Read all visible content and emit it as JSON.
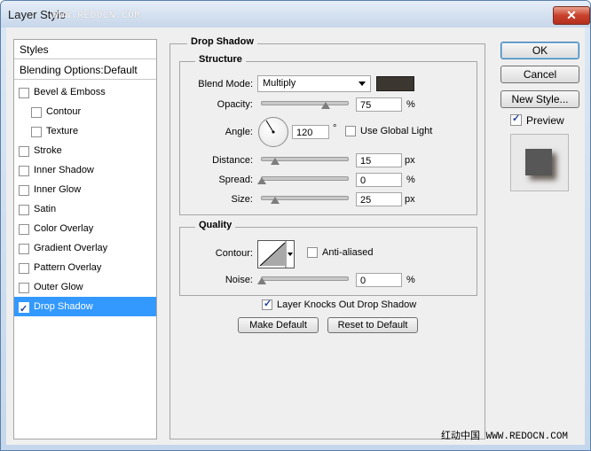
{
  "window": {
    "title": "Layer Style",
    "watermark_top": "WWW.REDOCN.COM",
    "close_glyph": "✕"
  },
  "left_panel": {
    "header_styles": "Styles",
    "header_blending": "Blending Options:Default",
    "items": [
      {
        "label": "Bevel & Emboss",
        "checked": false
      },
      {
        "label": "Contour",
        "checked": false
      },
      {
        "label": "Texture",
        "checked": false
      },
      {
        "label": "Stroke",
        "checked": false
      },
      {
        "label": "Inner Shadow",
        "checked": false
      },
      {
        "label": "Inner Glow",
        "checked": false
      },
      {
        "label": "Satin",
        "checked": false
      },
      {
        "label": "Color Overlay",
        "checked": false
      },
      {
        "label": "Gradient Overlay",
        "checked": false
      },
      {
        "label": "Pattern Overlay",
        "checked": false
      },
      {
        "label": "Outer Glow",
        "checked": false
      },
      {
        "label": "Drop Shadow",
        "checked": true
      }
    ]
  },
  "drop_shadow": {
    "group_title": "Drop Shadow",
    "structure": {
      "title": "Structure",
      "blend_mode_label": "Blend Mode:",
      "blend_mode_value": "Multiply",
      "blend_color": "#3c3630",
      "opacity_label": "Opacity:",
      "opacity_value": "75",
      "opacity_unit": "%",
      "opacity_fraction": 0.75,
      "angle_label": "Angle:",
      "angle_value": "120",
      "angle_unit": "°",
      "global_light_label": "Use Global Light",
      "global_light_checked": false,
      "distance_label": "Distance:",
      "distance_value": "15",
      "distance_unit": "px",
      "distance_fraction": 0.06,
      "spread_label": "Spread:",
      "spread_value": "0",
      "spread_unit": "%",
      "spread_fraction": 0.0,
      "size_label": "Size:",
      "size_value": "25",
      "size_unit": "px",
      "size_fraction": 0.1
    },
    "quality": {
      "title": "Quality",
      "contour_label": "Contour:",
      "anti_aliased_label": "Anti-aliased",
      "anti_aliased_checked": false,
      "noise_label": "Noise:",
      "noise_value": "0",
      "noise_unit": "%",
      "noise_fraction": 0.0
    },
    "knockout_label": "Layer Knocks Out Drop Shadow",
    "knockout_checked": true,
    "make_default_label": "Make Default",
    "reset_default_label": "Reset to Default"
  },
  "right_panel": {
    "ok_label": "OK",
    "cancel_label": "Cancel",
    "new_style_label": "New Style...",
    "preview_label": "Preview",
    "preview_checked": true
  },
  "watermark_bottom": "红动中国 WWW.REDOCN.COM",
  "colors": {
    "selection": "#3399ff",
    "dialog_bg": "#efefef"
  }
}
